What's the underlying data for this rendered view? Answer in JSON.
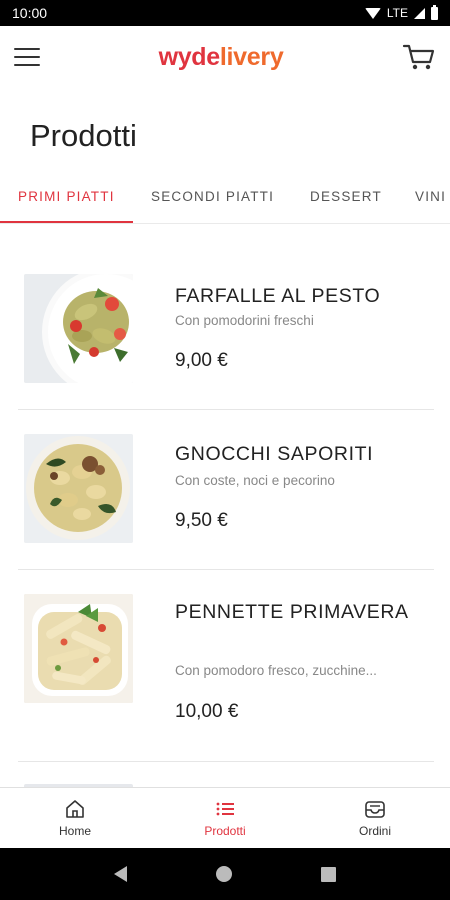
{
  "status_bar": {
    "time": "10:00",
    "network": "LTE"
  },
  "app_bar": {
    "logo_part1": "wyde",
    "logo_part2": "livery",
    "colors": {
      "brand_red": "#e0343f",
      "brand_orange": "#ef6a2d"
    }
  },
  "page": {
    "title": "Prodotti"
  },
  "tabs": [
    {
      "label": "PRIMI PIATTI",
      "active": true
    },
    {
      "label": "SECONDI PIATTI",
      "active": false
    },
    {
      "label": "DESSERT",
      "active": false
    },
    {
      "label": "VINI",
      "active": false
    }
  ],
  "products": [
    {
      "name": "FARFALLE AL PESTO",
      "description": "Con pomodorini freschi",
      "price": "9,00 €"
    },
    {
      "name": "GNOCCHI SAPORITI",
      "description": "Con coste, noci e pecorino",
      "price": "9,50 €"
    },
    {
      "name": "PENNETTE PRIMAVERA",
      "description": "Con pomodoro fresco, zucchine...",
      "price": "10,00 €"
    }
  ],
  "bottom_nav": [
    {
      "label": "Home",
      "icon": "home-icon",
      "active": false
    },
    {
      "label": "Prodotti",
      "icon": "list-icon",
      "active": true
    },
    {
      "label": "Ordini",
      "icon": "inbox-icon",
      "active": false
    }
  ]
}
